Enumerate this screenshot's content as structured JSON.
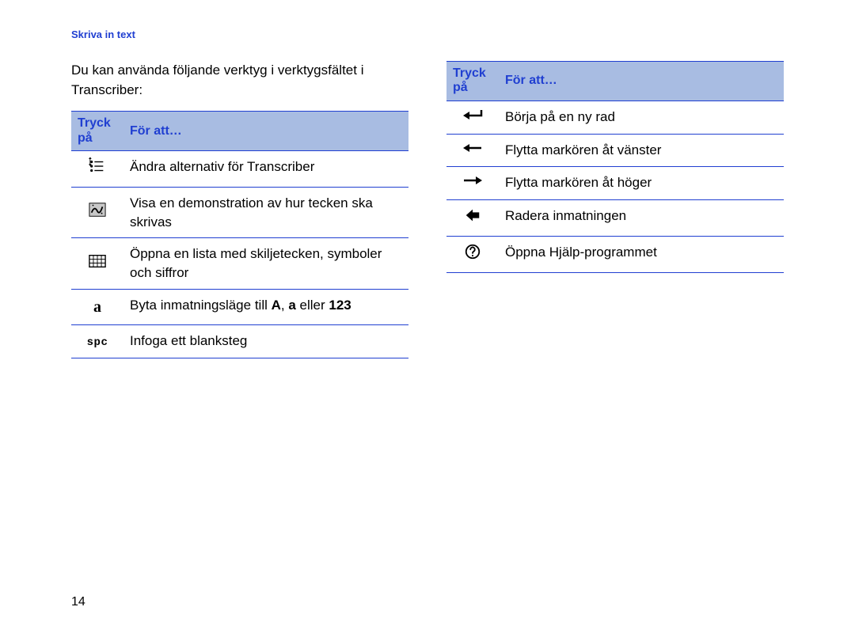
{
  "chapter_title": "Skriva in text",
  "intro": "Du kan använda följande verktyg i verktygsfältet i Transcriber:",
  "page_number": "14",
  "table_header": {
    "col1": "Tryck på",
    "col2": "För att…"
  },
  "left_rows": [
    {
      "icon": "options-icon",
      "text_parts": [
        "Ändra alternativ för Transcriber"
      ]
    },
    {
      "icon": "demo-icon",
      "text_parts": [
        "Visa en demonstration av hur tecken ska skrivas"
      ]
    },
    {
      "icon": "keyboard-icon",
      "text_parts": [
        "Öppna en lista med skiljetecken, symboler och siffror"
      ]
    },
    {
      "icon": "letter-a-icon",
      "text_parts": [
        "Byta inmatningsläge till ",
        "A",
        ", ",
        "a",
        " eller ",
        "123"
      ]
    },
    {
      "icon": "space-icon",
      "icon_text": "spc",
      "text_parts": [
        "Infoga ett blanksteg"
      ]
    }
  ],
  "right_rows": [
    {
      "icon": "enter-icon",
      "text_parts": [
        "Börja på en ny rad"
      ]
    },
    {
      "icon": "left-arrow-icon",
      "text_parts": [
        "Flytta markören åt vänster"
      ]
    },
    {
      "icon": "right-arrow-icon",
      "text_parts": [
        "Flytta markören åt höger"
      ]
    },
    {
      "icon": "backspace-icon",
      "text_parts": [
        "Radera inmatningen"
      ]
    },
    {
      "icon": "help-icon",
      "text_parts": [
        "Öppna Hjälp-programmet"
      ]
    }
  ]
}
